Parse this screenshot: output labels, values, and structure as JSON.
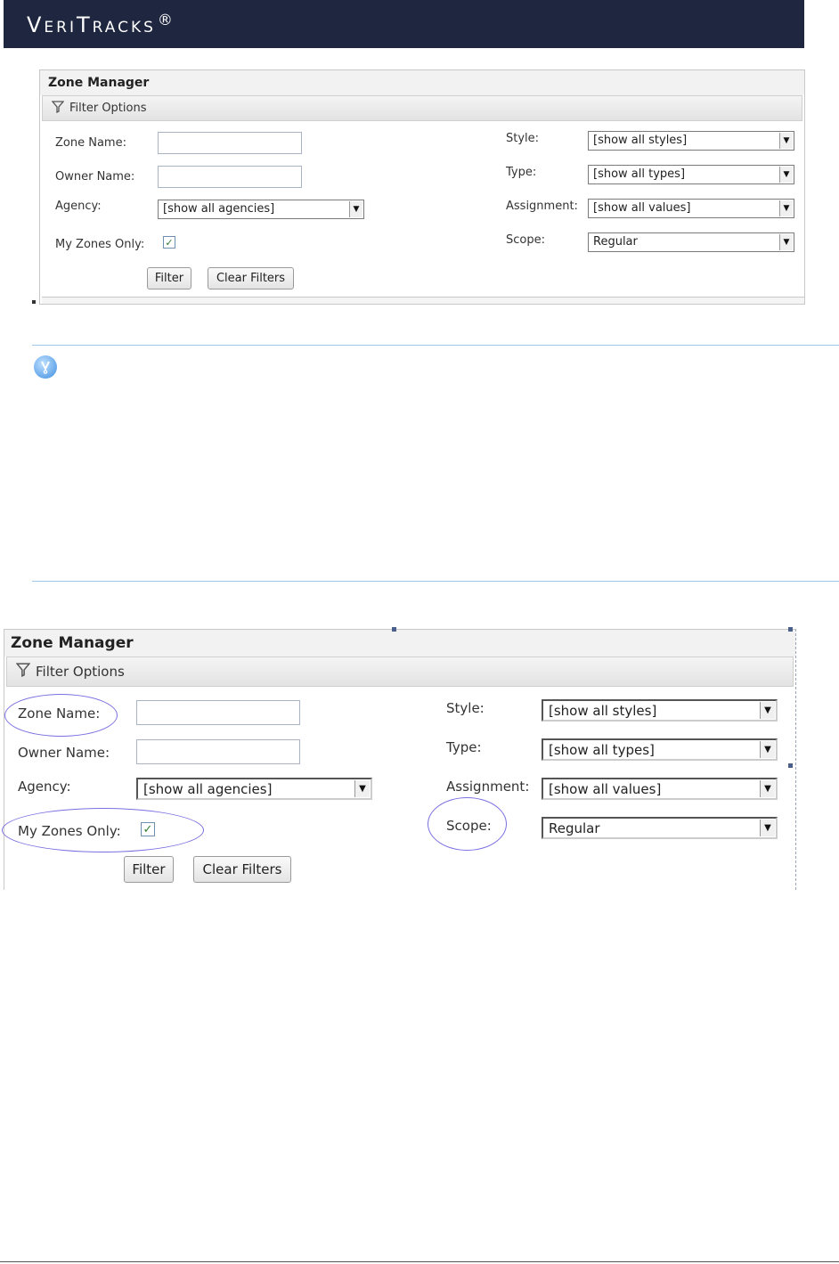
{
  "brand": {
    "name": "VeriTracks",
    "mark": "®"
  },
  "panel": {
    "title": "Zone Manager",
    "filter_options": "Filter Options",
    "labels": {
      "zone_name": "Zone Name:",
      "owner_name": "Owner Name:",
      "agency": "Agency:",
      "my_zones_only": "My Zones Only:",
      "style": "Style:",
      "type": "Type:",
      "assignment": "Assignment:",
      "scope": "Scope:"
    },
    "fields": {
      "zone_name": "",
      "owner_name": "",
      "agency": "[show all agencies]",
      "style": "[show all styles]",
      "type": "[show all types]",
      "assignment": "[show all values]",
      "scope": "Regular",
      "my_zones_only_checked": true
    },
    "buttons": {
      "filter": "Filter",
      "clear_filters": "Clear Filters"
    }
  },
  "callout": {
    "icon": "info-icon"
  },
  "highlighted_fields": [
    "Zone Name:",
    "My Zones Only:",
    "Scope:"
  ]
}
